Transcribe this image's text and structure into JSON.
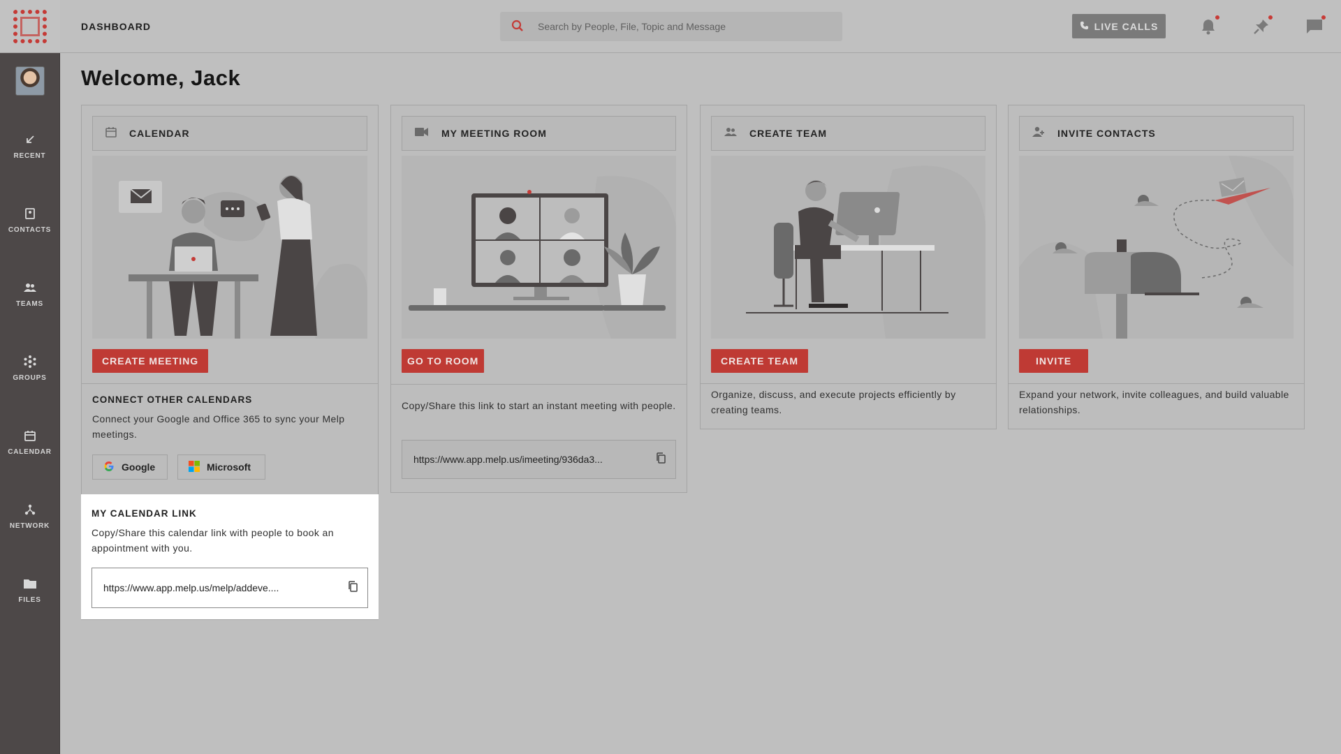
{
  "sidebar": {
    "items": [
      {
        "label": "RECENT",
        "icon": "arrow-down-left-icon"
      },
      {
        "label": "CONTACTS",
        "icon": "contact-book-icon"
      },
      {
        "label": "TEAMS",
        "icon": "team-icon"
      },
      {
        "label": "GROUPS",
        "icon": "groups-icon"
      },
      {
        "label": "CALENDAR",
        "icon": "calendar-icon"
      },
      {
        "label": "NETWORK",
        "icon": "network-icon"
      },
      {
        "label": "FILES",
        "icon": "folder-icon"
      }
    ]
  },
  "header": {
    "title": "DASHBOARD",
    "search_placeholder": "Search by People, File, Topic and Message",
    "live_calls": "LIVE CALLS"
  },
  "main": {
    "welcome": "Welcome, Jack",
    "calendar_card": {
      "title": "CALENDAR",
      "button": "CREATE MEETING",
      "connect_title": "CONNECT OTHER CALENDARS",
      "connect_text": "Connect your Google and Office 365 to sync your Melp meetings.",
      "google": "Google",
      "microsoft": "Microsoft",
      "link_title": "MY CALENDAR LINK",
      "link_text": "Copy/Share this calendar link with people to book an appointment with you.",
      "link_url": "https://www.app.melp.us/melp/addeve...."
    },
    "meeting_card": {
      "title": "MY MEETING ROOM",
      "button": "GO TO ROOM",
      "text": "Copy/Share this link to start an instant meeting with people.",
      "link_url": "https://www.app.melp.us/imeeting/936da3..."
    },
    "team_card": {
      "title": "CREATE TEAM",
      "button": "CREATE TEAM",
      "text": "Organize, discuss, and execute projects efficiently by creating teams."
    },
    "invite_card": {
      "title": "INVITE CONTACTS",
      "button": "INVITE",
      "text": "Expand your network, invite colleagues, and build valuable relationships."
    }
  },
  "colors": {
    "accent": "#c0392b",
    "sidebar": "#4d4848",
    "overlay": "#bfbfbf"
  }
}
